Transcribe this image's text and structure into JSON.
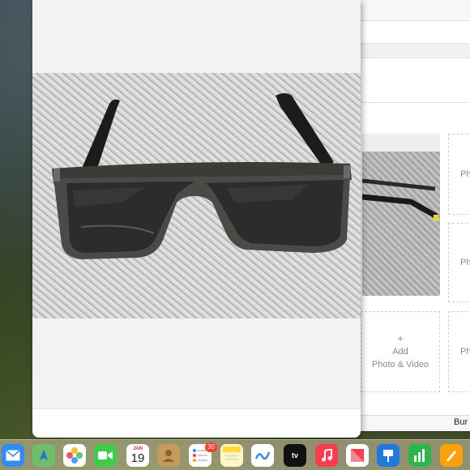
{
  "desktop": {
    "wallpaper": "mountain-forest-wallpaper"
  },
  "photo_viewer": {
    "image_subject": "sunglasses-on-carbon-fiber"
  },
  "listing_editor": {
    "slots": [
      {
        "label_top": "Ph",
        "label_bottom": ""
      },
      {
        "label_top": "Ph",
        "label_bottom": ""
      },
      {
        "label_top": "+",
        "label_bottom": "Add",
        "label_extra": "Photo & Video"
      },
      {
        "label_top": "Ph",
        "label_bottom": ""
      }
    ],
    "bottom_button": "Bur"
  },
  "dock": {
    "calendar_month": "JAN",
    "calendar_day": "19",
    "reminders_badge": "30",
    "apps": [
      {
        "name": "mail-icon",
        "color": "#2f8cf0"
      },
      {
        "name": "maps-icon",
        "color": "#4fae4f"
      },
      {
        "name": "photos-icon",
        "color": "#ffffff"
      },
      {
        "name": "facetime-icon",
        "color": "#3ccd4b"
      },
      {
        "name": "calendar-icon",
        "color": "#ffffff"
      },
      {
        "name": "contacts-icon",
        "color": "#c7995d"
      },
      {
        "name": "reminders-icon",
        "color": "#ffffff"
      },
      {
        "name": "notes-icon",
        "color": "#ffd93b"
      },
      {
        "name": "freeform-icon",
        "color": "#ffffff"
      },
      {
        "name": "appletv-icon",
        "color": "#111111"
      },
      {
        "name": "music-icon",
        "color": "#fb3c4f"
      },
      {
        "name": "news-icon",
        "color": "#ffffff"
      },
      {
        "name": "keynote-icon",
        "color": "#1f7ae0"
      },
      {
        "name": "numbers-icon",
        "color": "#29b74a"
      },
      {
        "name": "pages-icon",
        "color": "#ff9f0a"
      }
    ],
    "tv_label": "tv"
  }
}
